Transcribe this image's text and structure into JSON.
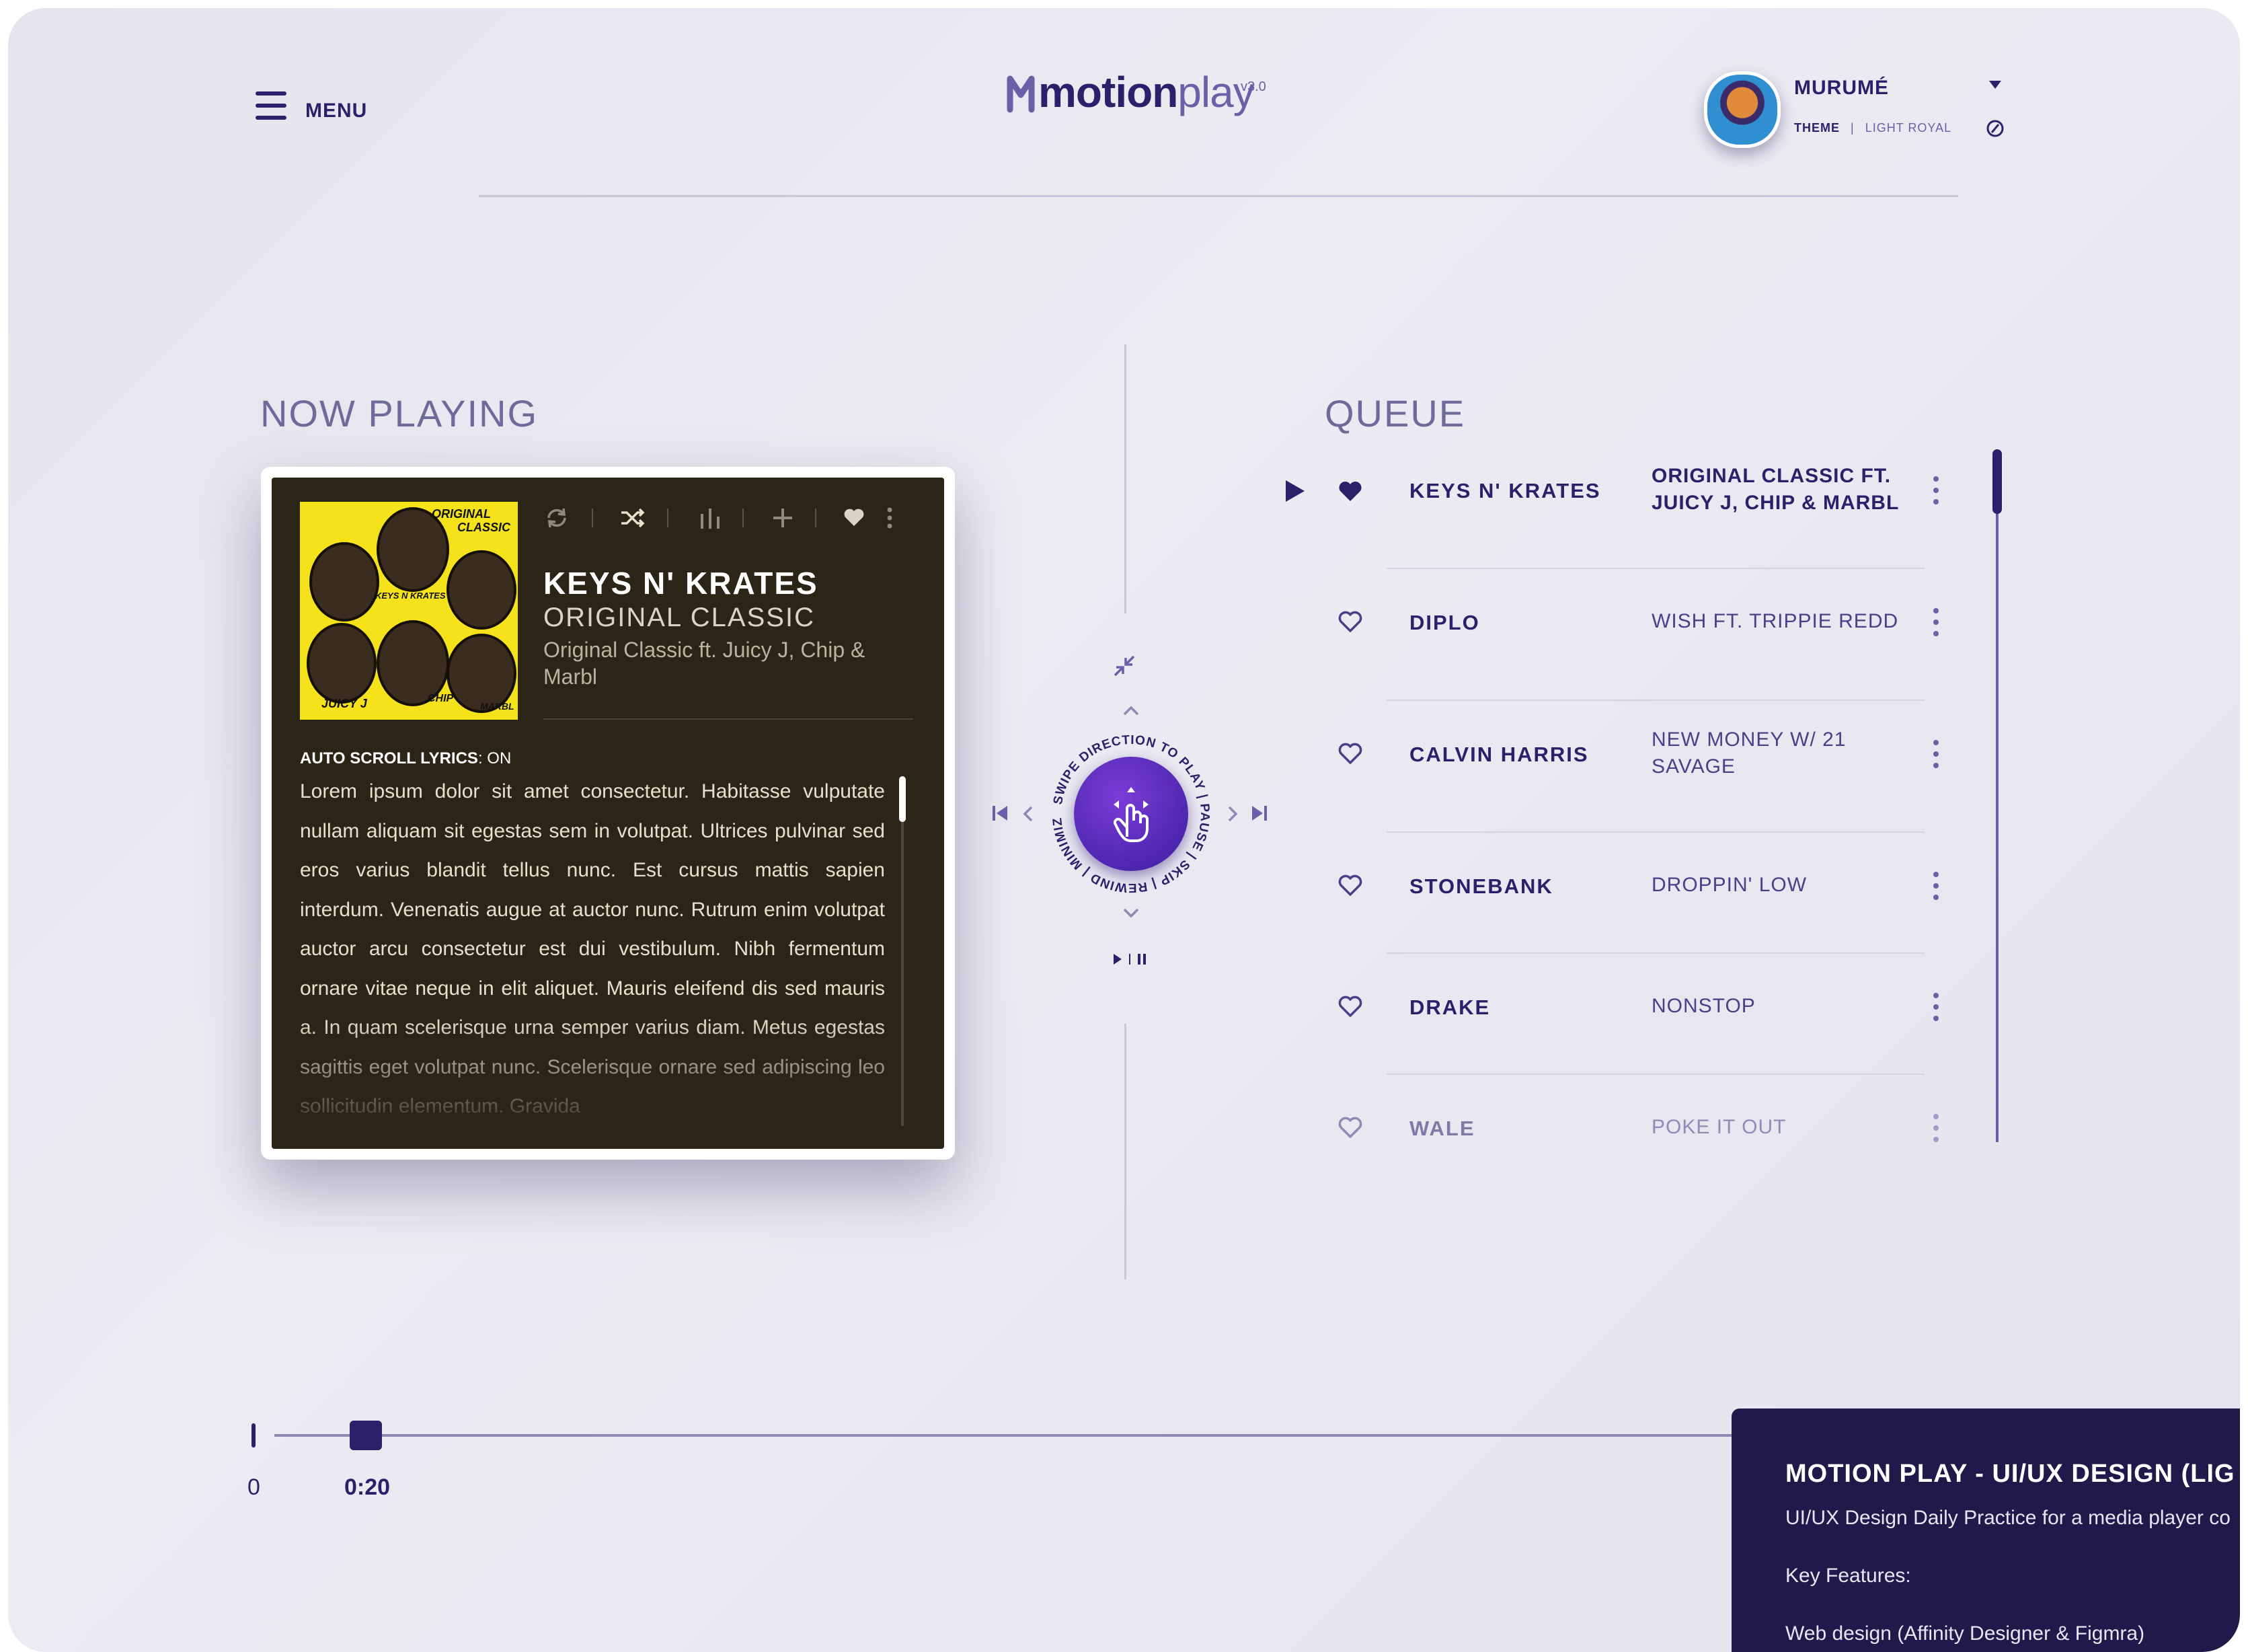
{
  "header": {
    "menu_label": "MENU",
    "logo_bold": "motion",
    "logo_light": "play",
    "logo_version": "v3.0",
    "user_name": "MURUMÉ",
    "theme_label": "THEME",
    "theme_value": "LIGHT ROYAL"
  },
  "now_playing": {
    "section_title": "NOW PLAYING",
    "artist": "KEYS N' KRATES",
    "album": "ORIGINAL CLASSIC",
    "track": "Original Classic ft. Juicy J, Chip & Marbl",
    "album_art_text": [
      "ORIGINAL",
      "CLASSIC",
      "KEYS N KRATES",
      "JUICY J",
      "CHIP",
      "MARBL"
    ],
    "lyrics_flag_label": "AUTO SCROLL LYRICS",
    "lyrics_flag_value": ": ON",
    "lyrics": "Lorem ipsum dolor sit amet consectetur. Habitasse vulputate nullam aliquam sit egestas sem in volutpat. Ultrices pulvinar sed eros varius blandit tellus nunc. Est cursus mattis sapien interdum. Venenatis augue at auctor nunc. Rutrum enim volutpat auctor arcu consectetur est dui vestibulum. Nibh fermentum ornare vitae neque in elit aliquet. Mauris eleifend dis sed mauris a. In quam scelerisque urna semper varius diam. Metus egestas sagittis eget volutpat nunc. Scelerisque ornare sed adipiscing leo sollicitudin elementum. Gravida"
  },
  "controls": {
    "dial_text": "SWIPE DIRECTION TO PLAY | PAUSE | SKIP | REWIND | MINIMIZE",
    "icons": [
      "minimize-icon",
      "chevron-up-icon",
      "skip-previous-icon",
      "chevron-left-icon",
      "chevron-right-icon",
      "skip-next-icon",
      "chevron-down-icon",
      "play-pause-icon",
      "swipe-hand-icon"
    ]
  },
  "queue": {
    "section_title": "QUEUE",
    "items": [
      {
        "artist": "KEYS N' KRATES",
        "title": "ORIGINAL CLASSIC FT. JUICY J, CHIP & MARBL",
        "playing": true,
        "liked": true
      },
      {
        "artist": "DIPLO",
        "title": "WISH FT. TRIPPIE REDD",
        "playing": false,
        "liked": false
      },
      {
        "artist": "CALVIN HARRIS",
        "title": "NEW MONEY W/ 21 SAVAGE",
        "playing": false,
        "liked": false
      },
      {
        "artist": "STONEBANK",
        "title": "DROPPIN' LOW",
        "playing": false,
        "liked": false
      },
      {
        "artist": "DRAKE",
        "title": "NONSTOP",
        "playing": false,
        "liked": false
      },
      {
        "artist": "WALE",
        "title": "POKE IT OUT",
        "playing": false,
        "liked": false
      }
    ]
  },
  "progress": {
    "start_label": "0",
    "current_label": "0:20"
  },
  "info_panel": {
    "title": "MOTION PLAY - UI/UX DESIGN (LIG",
    "subtitle": "UI/UX Design Daily Practice for a media player co",
    "features_label": "Key Features:",
    "feature_1": "Web design (Affinity Designer & Figmra)"
  },
  "colors": {
    "brand": "#2d1f6a",
    "accent": "#6b5fa8",
    "dial": "#5a2bc4",
    "card_bg": "#2a2516",
    "album_yellow": "#f5e21a",
    "info_panel": "#1f1a4a"
  }
}
